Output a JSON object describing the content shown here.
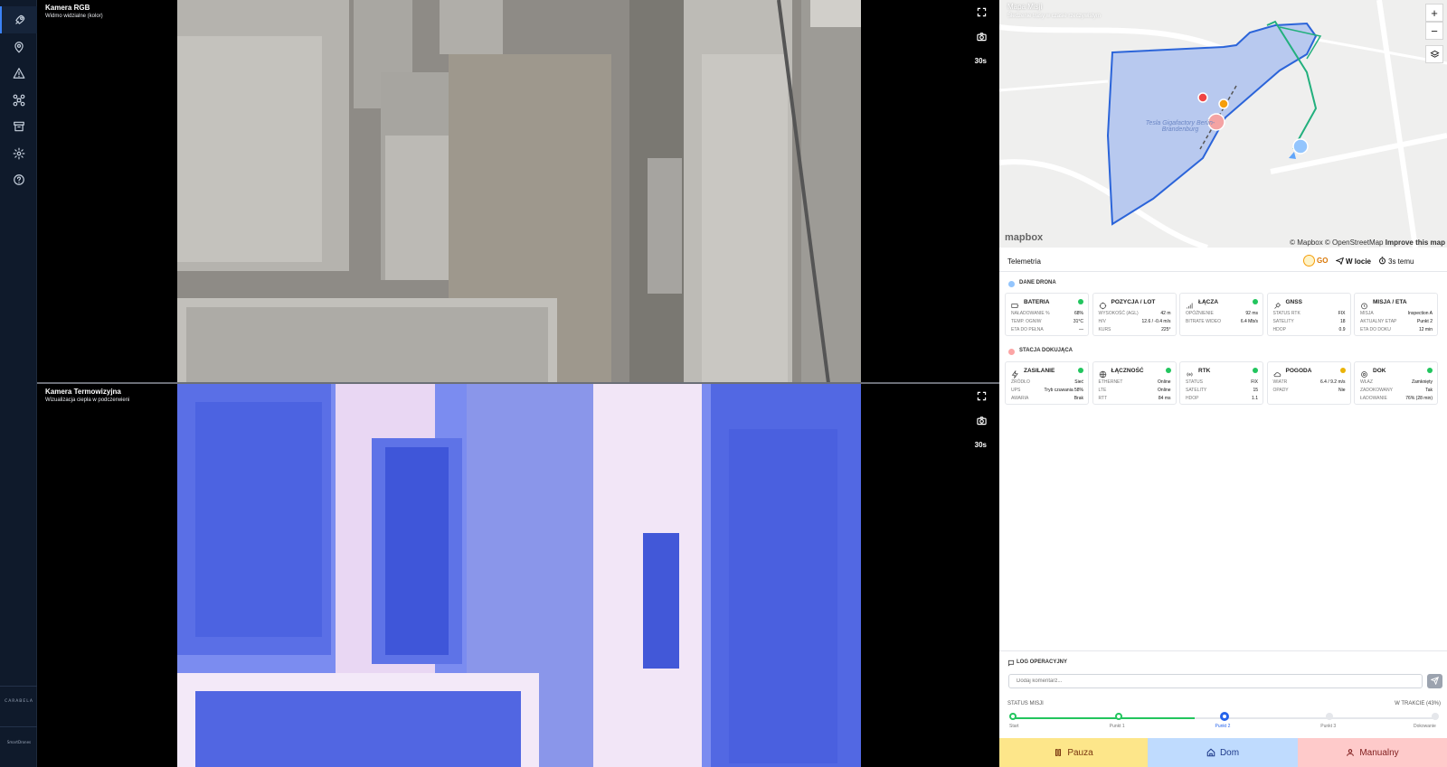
{
  "sidebar": {
    "brand_top": "CARABELA",
    "brand_bottom": "SmartDrones",
    "icons": [
      "rocket-icon",
      "map-pin-icon",
      "alert-icon",
      "drone-icon",
      "archive-icon",
      "gear-icon",
      "help-icon"
    ]
  },
  "cameras": {
    "rgb": {
      "title": "Kamera RGB",
      "subtitle": "Widmo widzialne (kolor)",
      "interval": "30s"
    },
    "thermal": {
      "title": "Kamera Termowizyjna",
      "subtitle": "Wizualizacja ciepła w podczerwieni",
      "interval": "30s"
    }
  },
  "map": {
    "title": "Mapa Misji",
    "subtitle": "Śledzenie trasy w czasie rzeczywistym",
    "zoom_in": "+",
    "zoom_out": "−",
    "logo": "mapbox",
    "attribution": "© Mapbox © OpenStreetMap",
    "improve": "Improve this map",
    "place_label": "Tesla Gigafactory Berlin-Brandenburg",
    "colors": {
      "geofence": "#b8c9ef",
      "geofence_border": "#2b64d9",
      "route": "#22b07d"
    }
  },
  "telemetry": {
    "title": "Telemetria",
    "go": "GO",
    "state": "W locie",
    "updated": "3s temu",
    "drone_section": "DANE DRONA",
    "dock_section": "STACJA DOKUJĄCA",
    "drone_cards": [
      {
        "title": "BATERIA",
        "status": "#22c55e",
        "rows": [
          [
            "NAŁADOWANIE %",
            "68%"
          ],
          [
            "TEMP. OGNIW",
            "31°C"
          ],
          [
            "ETA DO PEŁNA",
            "—"
          ]
        ]
      },
      {
        "title": "POZYCJA / LOT",
        "status": "",
        "rows": [
          [
            "WYSOKOŚĆ (AGL)",
            "42 m"
          ],
          [
            "H/V",
            "12.6 / -0.4 m/s"
          ],
          [
            "KURS",
            "225°"
          ]
        ]
      },
      {
        "title": "ŁĄCZA",
        "status": "#22c55e",
        "rows": [
          [
            "OPÓŹNIENIE",
            "92 ms"
          ],
          [
            "BITRATE WIDEO",
            "6.4 Mb/s"
          ],
          [
            "",
            ""
          ]
        ]
      },
      {
        "title": "GNSS",
        "status": "",
        "rows": [
          [
            "STATUS RTK",
            "FIX"
          ],
          [
            "SATELITY",
            "18"
          ],
          [
            "HDOP",
            "0.9"
          ]
        ]
      },
      {
        "title": "MISJA / ETA",
        "status": "",
        "rows": [
          [
            "MISJA",
            "Inspection A"
          ],
          [
            "AKTUALNY ETAP",
            "Punkt 2"
          ],
          [
            "ETA DO DOKU",
            "12 min"
          ]
        ]
      }
    ],
    "dock_cards": [
      {
        "title": "ZASILANIE",
        "status": "#22c55e",
        "rows": [
          [
            "ŹRÓDŁO",
            "Sieć"
          ],
          [
            "UPS",
            "Tryb czuwania 58%"
          ],
          [
            "AWARIA",
            "Brak"
          ]
        ]
      },
      {
        "title": "ŁĄCZNOŚĆ",
        "status": "#22c55e",
        "rows": [
          [
            "ETHERNET",
            "Online"
          ],
          [
            "LTE",
            "Online"
          ],
          [
            "RTT",
            "84 ms"
          ]
        ]
      },
      {
        "title": "RTK",
        "status": "#22c55e",
        "rows": [
          [
            "STATUS",
            "FIX"
          ],
          [
            "SATELITY",
            "15"
          ],
          [
            "HDOP",
            "1.1"
          ]
        ]
      },
      {
        "title": "POGODA",
        "status": "#eab308",
        "rows": [
          [
            "WIATR",
            "6.4 / 9.2 m/s"
          ],
          [
            "OPADY",
            "Nie"
          ],
          [
            "",
            ""
          ]
        ]
      },
      {
        "title": "DOK",
        "status": "#22c55e",
        "rows": [
          [
            "WŁAZ",
            "Zamknięty"
          ],
          [
            "ZADOKOWANY",
            "Tak"
          ],
          [
            "ŁADOWANIE",
            "76% (28 min)"
          ]
        ]
      }
    ]
  },
  "log": {
    "title": "LOG OPERACYJNY",
    "placeholder": "Dodaj komentarz..."
  },
  "mission": {
    "label": "STATUS MISJI",
    "status": "W TRAKCIE (43%)",
    "progress": 0.43,
    "waypoints": [
      "Start",
      "Punkt 1",
      "Punkt 2",
      "Punkt 3",
      "Dokowanie"
    ]
  },
  "actions": {
    "pause": "Pauza",
    "home": "Dom",
    "manual": "Manualny"
  }
}
